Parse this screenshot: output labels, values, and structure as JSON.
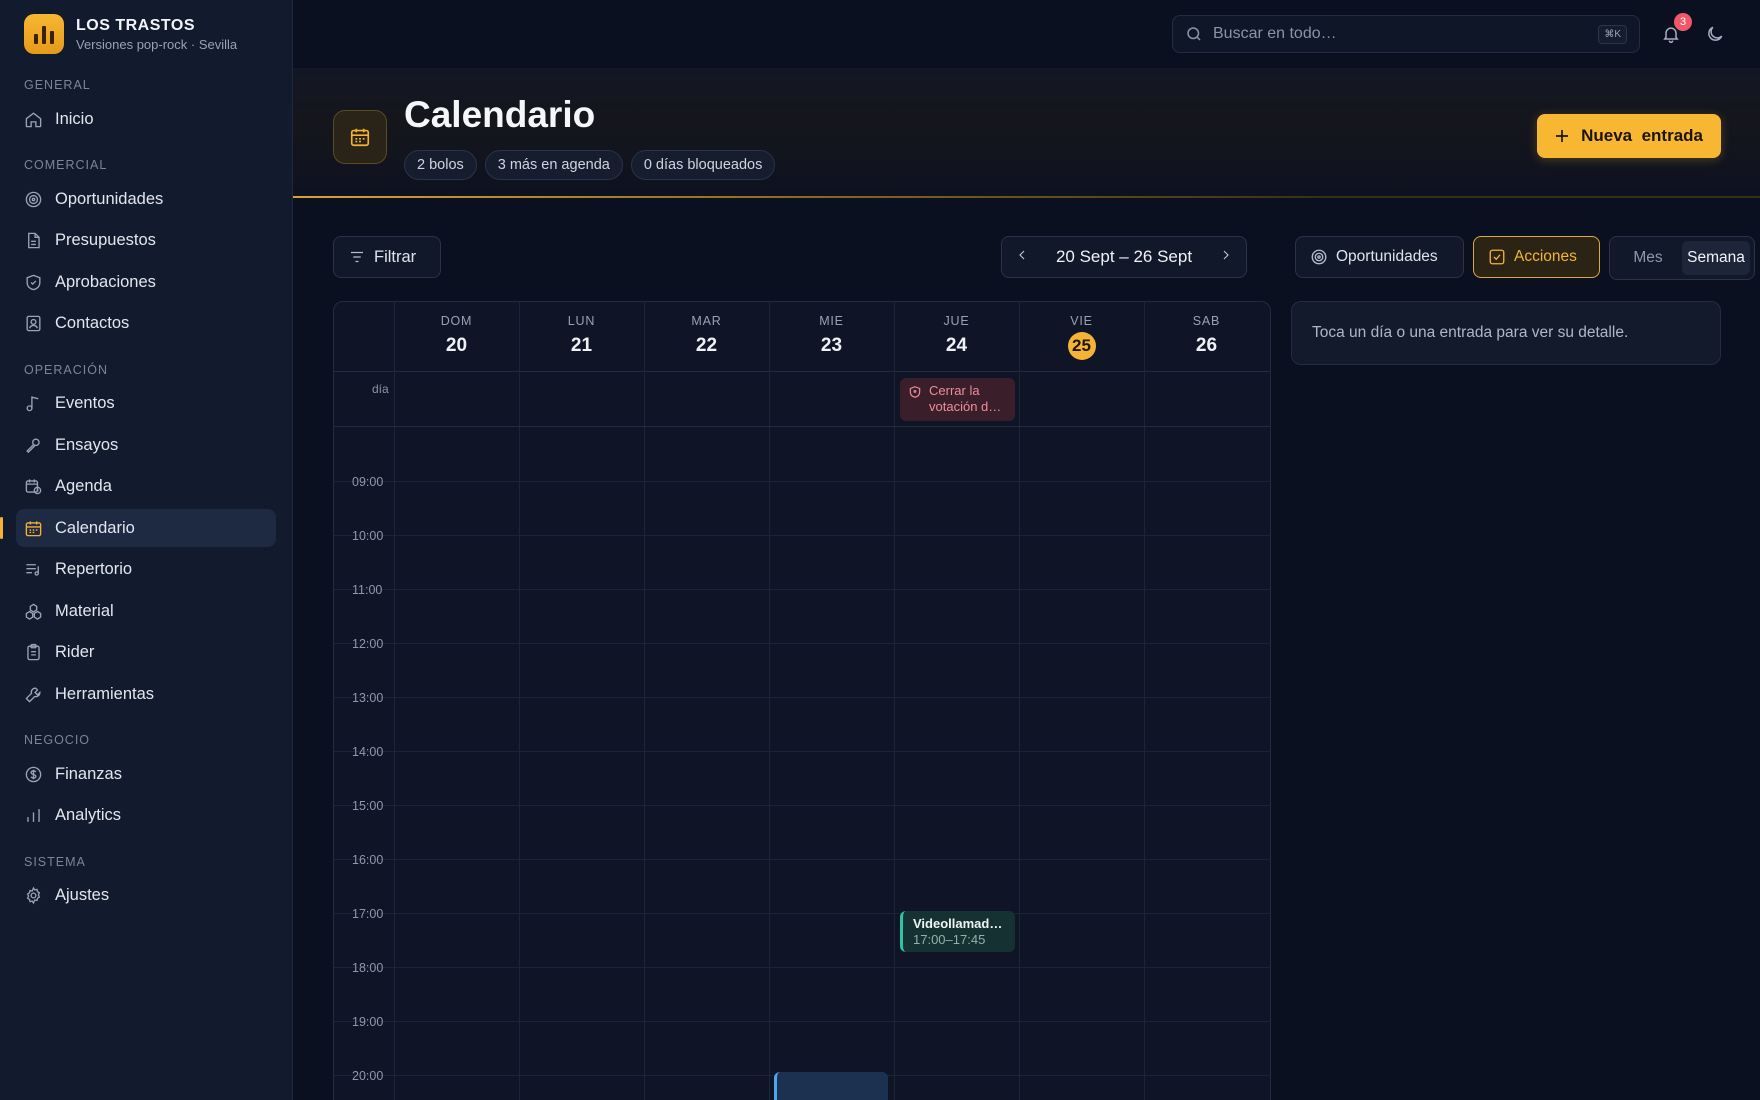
{
  "brand": {
    "name": "LOS TRASTOS",
    "subtitle": "Versiones pop-rock · Sevilla"
  },
  "sidebar": {
    "sections": [
      {
        "label": "GENERAL",
        "items": [
          {
            "label": "Inicio",
            "icon": "home-icon"
          }
        ]
      },
      {
        "label": "COMERCIAL",
        "items": [
          {
            "label": "Oportunidades",
            "icon": "target-icon"
          },
          {
            "label": "Presupuestos",
            "icon": "document-icon"
          },
          {
            "label": "Aprobaciones",
            "icon": "shield-check-icon"
          },
          {
            "label": "Contactos",
            "icon": "contact-card-icon"
          }
        ]
      },
      {
        "label": "OPERACIÓN",
        "items": [
          {
            "label": "Eventos",
            "icon": "music-note-icon"
          },
          {
            "label": "Ensayos",
            "icon": "microphone-icon"
          },
          {
            "label": "Agenda",
            "icon": "calendar-clock-icon"
          },
          {
            "label": "Calendario",
            "icon": "calendar-icon",
            "active": true
          },
          {
            "label": "Repertorio",
            "icon": "list-music-icon"
          },
          {
            "label": "Material",
            "icon": "boxes-icon"
          },
          {
            "label": "Rider",
            "icon": "clipboard-icon"
          },
          {
            "label": "Herramientas",
            "icon": "wrench-icon"
          }
        ]
      },
      {
        "label": "NEGOCIO",
        "items": [
          {
            "label": "Finanzas",
            "icon": "dollar-circle-icon"
          },
          {
            "label": "Analytics",
            "icon": "bar-chart-icon"
          }
        ]
      },
      {
        "label": "SISTEMA",
        "items": [
          {
            "label": "Ajustes",
            "icon": "gear-icon"
          }
        ]
      }
    ]
  },
  "topbar": {
    "search_placeholder": "Buscar en todo…",
    "shortcut": "⌘K",
    "notifications_count": "3"
  },
  "header": {
    "title": "Calendario",
    "chips": [
      "2 bolos",
      "3 más en agenda",
      "0 días bloqueados"
    ],
    "new_button": "Nueva  entrada"
  },
  "toolbar": {
    "filter": "Filtrar",
    "range": "20 Sept – 26 Sept",
    "opportunities": "Oportunidades",
    "actions": "Acciones",
    "view_month": "Mes",
    "view_week": "Semana"
  },
  "calendar": {
    "days": [
      {
        "dow": "DOM",
        "num": "20"
      },
      {
        "dow": "LUN",
        "num": "21"
      },
      {
        "dow": "MAR",
        "num": "22"
      },
      {
        "dow": "MIE",
        "num": "23"
      },
      {
        "dow": "JUE",
        "num": "24"
      },
      {
        "dow": "VIE",
        "num": "25",
        "today": true
      },
      {
        "dow": "SAB",
        "num": "26"
      }
    ],
    "allday_label": "día",
    "hours": [
      "09:00",
      "10:00",
      "11:00",
      "12:00",
      "13:00",
      "14:00",
      "15:00",
      "16:00",
      "17:00",
      "18:00",
      "19:00",
      "20:00"
    ],
    "events": {
      "action_title": "Cerrar la votación d…",
      "meeting_title": "Videollamada…",
      "meeting_time": "17:00–17:45"
    }
  },
  "detail": {
    "hint": "Toca un día o una entrada para ver su detalle."
  },
  "colors": {
    "accent": "#f5b335",
    "danger": "#f18c9b",
    "success": "#2fc3a1",
    "info": "#4aa7f0"
  }
}
